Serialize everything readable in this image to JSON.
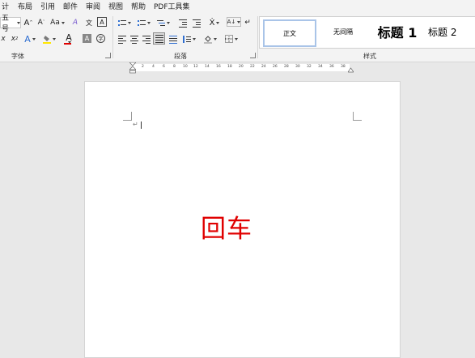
{
  "menu": {
    "items": [
      "计",
      "布局",
      "引用",
      "邮件",
      "审阅",
      "视图",
      "帮助",
      "PDF工具集"
    ]
  },
  "ribbon": {
    "font": {
      "font_size": "五号",
      "grow_label": "A",
      "shrink_label": "A",
      "case_label": "Aa",
      "clear_format_label": "A",
      "phonetic_label": "文",
      "char_border_label": "A",
      "subscript_label": "x",
      "superscript_label": "x",
      "text_effect_label": "A",
      "highlight_label": "",
      "font_color_label": "A",
      "char_shading_label": "A",
      "enclose_label": "字",
      "group_label": "字体"
    },
    "paragraph": {
      "group_label": "段落",
      "sort_label": "A↓"
    },
    "styles": {
      "group_label": "样式",
      "items": [
        {
          "label": "正文",
          "selected": true
        },
        {
          "label": "无间隔",
          "selected": false
        },
        {
          "label": "标题 1",
          "selected": false
        },
        {
          "label": "标题 2",
          "selected": false
        }
      ]
    }
  },
  "ruler": {
    "ticks": [
      "2",
      "4",
      "6",
      "8",
      "10",
      "12",
      "14",
      "16",
      "18",
      "20",
      "22",
      "24",
      "26",
      "28",
      "30",
      "32",
      "34",
      "36",
      "38"
    ]
  },
  "document": {
    "paragraph_mark": "↵",
    "body_text": "回车",
    "body_color": "#e00000"
  },
  "colors": {
    "highlight": "#ffe600",
    "font_color": "#e00000",
    "text_effect": "#2f6fd1"
  }
}
